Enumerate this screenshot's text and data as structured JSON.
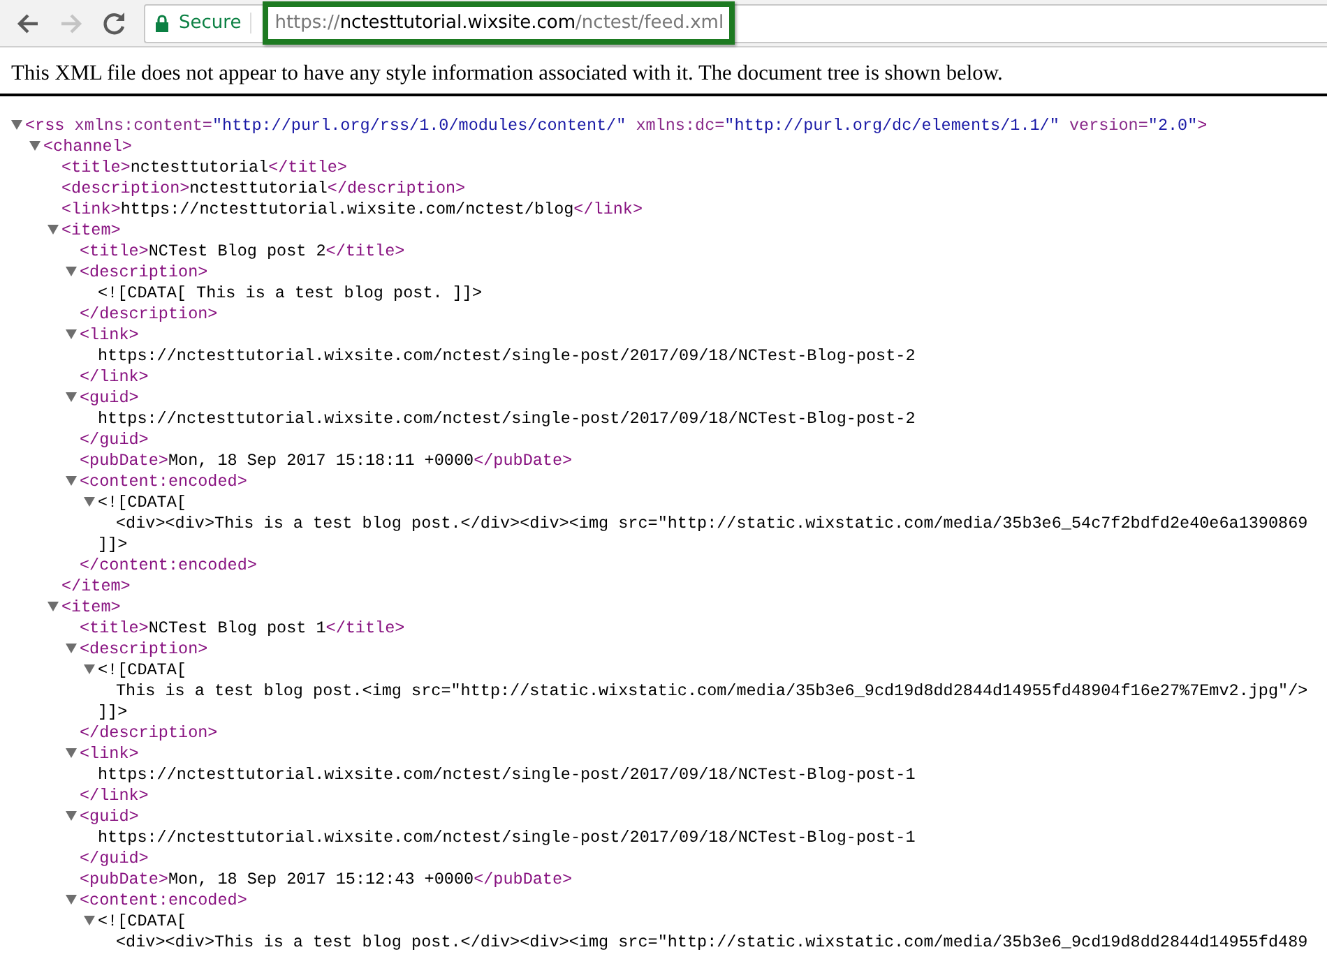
{
  "browser": {
    "back_enabled": true,
    "forward_enabled": false,
    "security_label": "Secure",
    "url": {
      "scheme": "https://",
      "host": "nctesttutorial.wixsite.com",
      "path": "/nctest/feed.xml",
      "highlighted": true
    }
  },
  "notice": "This XML file does not appear to have any style information associated with it. The document tree is shown below.",
  "xml": [
    {
      "kind": "element",
      "expanded": true,
      "open": [
        {
          "kind": "tag",
          "text": "<rss"
        },
        {
          "kind": "attr",
          "text": " xmlns:content="
        },
        {
          "kind": "value",
          "text": "\"http://purl.org/rss/1.0/modules/content/\""
        },
        {
          "kind": "attr",
          "text": " xmlns:dc="
        },
        {
          "kind": "value",
          "text": "\"http://purl.org/dc/elements/1.1/\""
        },
        {
          "kind": "attr",
          "text": " version="
        },
        {
          "kind": "value",
          "text": "\"2.0\""
        },
        {
          "kind": "tag",
          "text": ">"
        }
      ],
      "children": [
        {
          "kind": "element",
          "expanded": true,
          "open": [
            {
              "kind": "tag",
              "text": "<channel>"
            }
          ],
          "children": [
            {
              "kind": "line",
              "parts": [
                {
                  "kind": "tag",
                  "text": "<title>"
                },
                {
                  "kind": "text",
                  "text": "nctesttutorial"
                },
                {
                  "kind": "tag",
                  "text": "</title>"
                }
              ]
            },
            {
              "kind": "line",
              "parts": [
                {
                  "kind": "tag",
                  "text": "<description>"
                },
                {
                  "kind": "text",
                  "text": "nctesttutorial"
                },
                {
                  "kind": "tag",
                  "text": "</description>"
                }
              ]
            },
            {
              "kind": "line",
              "parts": [
                {
                  "kind": "tag",
                  "text": "<link>"
                },
                {
                  "kind": "text",
                  "text": "https://nctesttutorial.wixsite.com/nctest/blog"
                },
                {
                  "kind": "tag",
                  "text": "</link>"
                }
              ]
            },
            {
              "kind": "element",
              "expanded": true,
              "open": [
                {
                  "kind": "tag",
                  "text": "<item>"
                }
              ],
              "children": [
                {
                  "kind": "line",
                  "parts": [
                    {
                      "kind": "tag",
                      "text": "<title>"
                    },
                    {
                      "kind": "text",
                      "text": "NCTest Blog post 2"
                    },
                    {
                      "kind": "tag",
                      "text": "</title>"
                    }
                  ]
                },
                {
                  "kind": "element",
                  "expanded": true,
                  "open": [
                    {
                      "kind": "tag",
                      "text": "<description>"
                    }
                  ],
                  "children": [
                    {
                      "kind": "line",
                      "parts": [
                        {
                          "kind": "text",
                          "text": "<![CDATA[ This is a test blog post. ]]>"
                        }
                      ]
                    }
                  ],
                  "close": [
                    {
                      "kind": "tag",
                      "text": "</description>"
                    }
                  ]
                },
                {
                  "kind": "element",
                  "expanded": true,
                  "open": [
                    {
                      "kind": "tag",
                      "text": "<link>"
                    }
                  ],
                  "children": [
                    {
                      "kind": "line",
                      "parts": [
                        {
                          "kind": "text",
                          "text": "https://nctesttutorial.wixsite.com/nctest/single-post/2017/09/18/NCTest-Blog-post-2"
                        }
                      ]
                    }
                  ],
                  "close": [
                    {
                      "kind": "tag",
                      "text": "</link>"
                    }
                  ]
                },
                {
                  "kind": "element",
                  "expanded": true,
                  "open": [
                    {
                      "kind": "tag",
                      "text": "<guid>"
                    }
                  ],
                  "children": [
                    {
                      "kind": "line",
                      "parts": [
                        {
                          "kind": "text",
                          "text": "https://nctesttutorial.wixsite.com/nctest/single-post/2017/09/18/NCTest-Blog-post-2"
                        }
                      ]
                    }
                  ],
                  "close": [
                    {
                      "kind": "tag",
                      "text": "</guid>"
                    }
                  ]
                },
                {
                  "kind": "line",
                  "parts": [
                    {
                      "kind": "tag",
                      "text": "<pubDate>"
                    },
                    {
                      "kind": "text",
                      "text": "Mon, 18 Sep 2017 15:18:11 +0000"
                    },
                    {
                      "kind": "tag",
                      "text": "</pubDate>"
                    }
                  ]
                },
                {
                  "kind": "element",
                  "expanded": true,
                  "open": [
                    {
                      "kind": "tag",
                      "text": "<content:encoded>"
                    }
                  ],
                  "children": [
                    {
                      "kind": "element",
                      "expanded": true,
                      "open": [
                        {
                          "kind": "text",
                          "text": "<![CDATA["
                        }
                      ],
                      "children": [
                        {
                          "kind": "line",
                          "parts": [
                            {
                              "kind": "text",
                              "text": "<div><div>This is a test blog post.</div><div><img src=\"http://static.wixstatic.com/media/35b3e6_54c7f2bdfd2e40e6a1390869"
                            }
                          ]
                        }
                      ],
                      "close": [
                        {
                          "kind": "text",
                          "text": "]]>"
                        }
                      ]
                    }
                  ],
                  "close": [
                    {
                      "kind": "tag",
                      "text": "</content:encoded>"
                    }
                  ]
                }
              ],
              "close": [
                {
                  "kind": "tag",
                  "text": "</item>"
                }
              ]
            },
            {
              "kind": "element",
              "expanded": true,
              "open": [
                {
                  "kind": "tag",
                  "text": "<item>"
                }
              ],
              "children": [
                {
                  "kind": "line",
                  "parts": [
                    {
                      "kind": "tag",
                      "text": "<title>"
                    },
                    {
                      "kind": "text",
                      "text": "NCTest Blog post 1"
                    },
                    {
                      "kind": "tag",
                      "text": "</title>"
                    }
                  ]
                },
                {
                  "kind": "element",
                  "expanded": true,
                  "open": [
                    {
                      "kind": "tag",
                      "text": "<description>"
                    }
                  ],
                  "children": [
                    {
                      "kind": "element",
                      "expanded": true,
                      "open": [
                        {
                          "kind": "text",
                          "text": "<![CDATA["
                        }
                      ],
                      "children": [
                        {
                          "kind": "line",
                          "parts": [
                            {
                              "kind": "text",
                              "text": "This is a test blog post.<img src=\"http://static.wixstatic.com/media/35b3e6_9cd19d8dd2844d14955fd48904f16e27%7Emv2.jpg\"/>"
                            }
                          ]
                        }
                      ],
                      "close": [
                        {
                          "kind": "text",
                          "text": "]]>"
                        }
                      ]
                    }
                  ],
                  "close": [
                    {
                      "kind": "tag",
                      "text": "</description>"
                    }
                  ]
                },
                {
                  "kind": "element",
                  "expanded": true,
                  "open": [
                    {
                      "kind": "tag",
                      "text": "<link>"
                    }
                  ],
                  "children": [
                    {
                      "kind": "line",
                      "parts": [
                        {
                          "kind": "text",
                          "text": "https://nctesttutorial.wixsite.com/nctest/single-post/2017/09/18/NCTest-Blog-post-1"
                        }
                      ]
                    }
                  ],
                  "close": [
                    {
                      "kind": "tag",
                      "text": "</link>"
                    }
                  ]
                },
                {
                  "kind": "element",
                  "expanded": true,
                  "open": [
                    {
                      "kind": "tag",
                      "text": "<guid>"
                    }
                  ],
                  "children": [
                    {
                      "kind": "line",
                      "parts": [
                        {
                          "kind": "text",
                          "text": "https://nctesttutorial.wixsite.com/nctest/single-post/2017/09/18/NCTest-Blog-post-1"
                        }
                      ]
                    }
                  ],
                  "close": [
                    {
                      "kind": "tag",
                      "text": "</guid>"
                    }
                  ]
                },
                {
                  "kind": "line",
                  "parts": [
                    {
                      "kind": "tag",
                      "text": "<pubDate>"
                    },
                    {
                      "kind": "text",
                      "text": "Mon, 18 Sep 2017 15:12:43 +0000"
                    },
                    {
                      "kind": "tag",
                      "text": "</pubDate>"
                    }
                  ]
                },
                {
                  "kind": "element",
                  "expanded": true,
                  "open": [
                    {
                      "kind": "tag",
                      "text": "<content:encoded>"
                    }
                  ],
                  "children": [
                    {
                      "kind": "element",
                      "expanded": true,
                      "open": [
                        {
                          "kind": "text",
                          "text": "<![CDATA["
                        }
                      ],
                      "children": [
                        {
                          "kind": "line",
                          "parts": [
                            {
                              "kind": "text",
                              "text": "<div><div>This is a test blog post.</div><div><img src=\"http://static.wixstatic.com/media/35b3e6_9cd19d8dd2844d14955fd489"
                            }
                          ]
                        }
                      ]
                    }
                  ]
                }
              ]
            }
          ]
        }
      ]
    }
  ]
}
